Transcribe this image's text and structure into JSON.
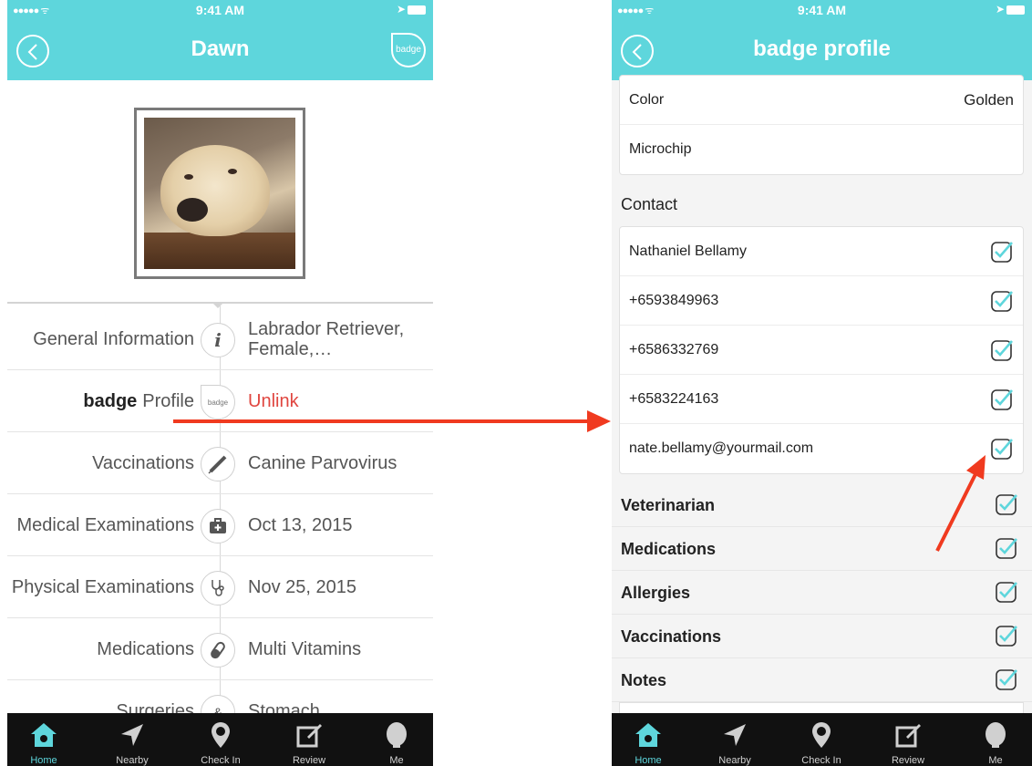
{
  "status": {
    "signal": "●●●●● ᯤ",
    "time": "9:41 AM"
  },
  "left": {
    "title": "Dawn",
    "badge_button": "badge",
    "rows": [
      {
        "label": "General Information",
        "icon": "i",
        "value": "Labrador Retriever,\nFemale,…"
      },
      {
        "label_brand": "badge",
        "label": "Profile",
        "icon": "badge",
        "value": "Unlink"
      },
      {
        "label": "Vaccinations",
        "icon": "syringe-icon",
        "value": "Canine Parvovirus"
      },
      {
        "label": "Medical Examinations",
        "icon": "medkit-icon",
        "value": "Oct 13, 2015"
      },
      {
        "label": "Physical Examinations",
        "icon": "stethoscope-icon",
        "value": "Nov 25, 2015"
      },
      {
        "label": "Medications",
        "icon": "pill-icon",
        "value": "Multi Vitamins"
      },
      {
        "label": "Surgeries",
        "icon": "surgery-icon",
        "value": "Stomach"
      }
    ]
  },
  "right": {
    "title": "badge profile",
    "details": [
      {
        "label": "Color",
        "value": "Golden"
      },
      {
        "label": "Microchip",
        "value": ""
      }
    ],
    "contact_title": "Contact",
    "contacts": [
      "Nathaniel Bellamy",
      "+6593849963",
      "+6586332769",
      "+6583224163",
      "nate.bellamy@yourmail.com"
    ],
    "sections": [
      "Veterinarian",
      "Medications",
      "Allergies",
      "Vaccinations",
      "Notes"
    ]
  },
  "tabs": [
    {
      "label": "Home",
      "icon": "home-icon"
    },
    {
      "label": "Nearby",
      "icon": "location-arrow-icon"
    },
    {
      "label": "Check In",
      "icon": "paw-pin-icon"
    },
    {
      "label": "Review",
      "icon": "edit-icon"
    },
    {
      "label": "Me",
      "icon": "person-icon"
    }
  ],
  "colors": {
    "accent": "#5ed6dc",
    "arrow": "#f03a1f",
    "unlink": "#e0453f"
  }
}
